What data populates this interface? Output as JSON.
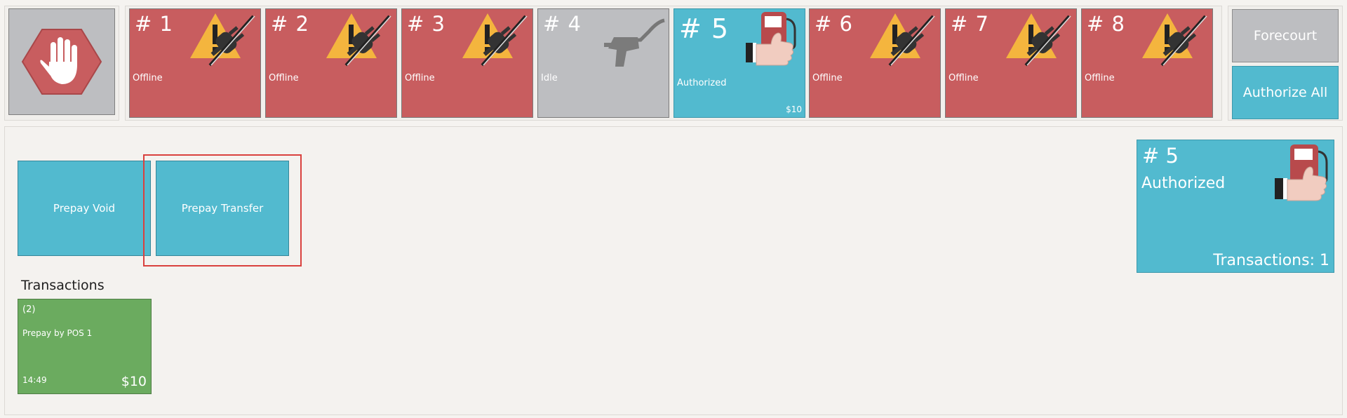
{
  "stop": {
    "icon": "stop-hand-icon"
  },
  "pumps": [
    {
      "number": "# 1",
      "status": "Offline",
      "state": "offline",
      "icon": "offline-warning-plug-icon"
    },
    {
      "number": "# 2",
      "status": "Offline",
      "state": "offline",
      "icon": "offline-warning-plug-icon"
    },
    {
      "number": "# 3",
      "status": "Offline",
      "state": "offline",
      "icon": "offline-warning-plug-icon"
    },
    {
      "number": "# 4",
      "status": "Idle",
      "state": "idle",
      "icon": "fuel-nozzle-icon"
    },
    {
      "number": "# 5",
      "status": "Authorized",
      "state": "authorized",
      "amount": "$10",
      "icon": "fuel-pump-thumbs-up-icon"
    },
    {
      "number": "# 6",
      "status": "Offline",
      "state": "offline",
      "icon": "offline-warning-plug-icon"
    },
    {
      "number": "# 7",
      "status": "Offline",
      "state": "offline",
      "icon": "offline-warning-plug-icon"
    },
    {
      "number": "# 8",
      "status": "Offline",
      "state": "offline",
      "icon": "offline-warning-plug-icon"
    }
  ],
  "actions": {
    "forecourt": "Forecourt",
    "authorize_all": "Authorize All"
  },
  "operations": {
    "prepay_void": "Prepay Void",
    "prepay_transfer": "Prepay Transfer"
  },
  "transactions": {
    "heading": "Transactions",
    "items": [
      {
        "count": "(2)",
        "description": "Prepay by POS 1",
        "time": "14:49",
        "amount": "$10"
      }
    ]
  },
  "selected_pump": {
    "number": "# 5",
    "status": "Authorized",
    "transactions": "Transactions: 1"
  },
  "colors": {
    "offline": "#c85d5f",
    "idle": "#bdbec1",
    "authorized": "#52bacf",
    "transaction": "#6bab5f",
    "highlight": "#d9413e"
  }
}
